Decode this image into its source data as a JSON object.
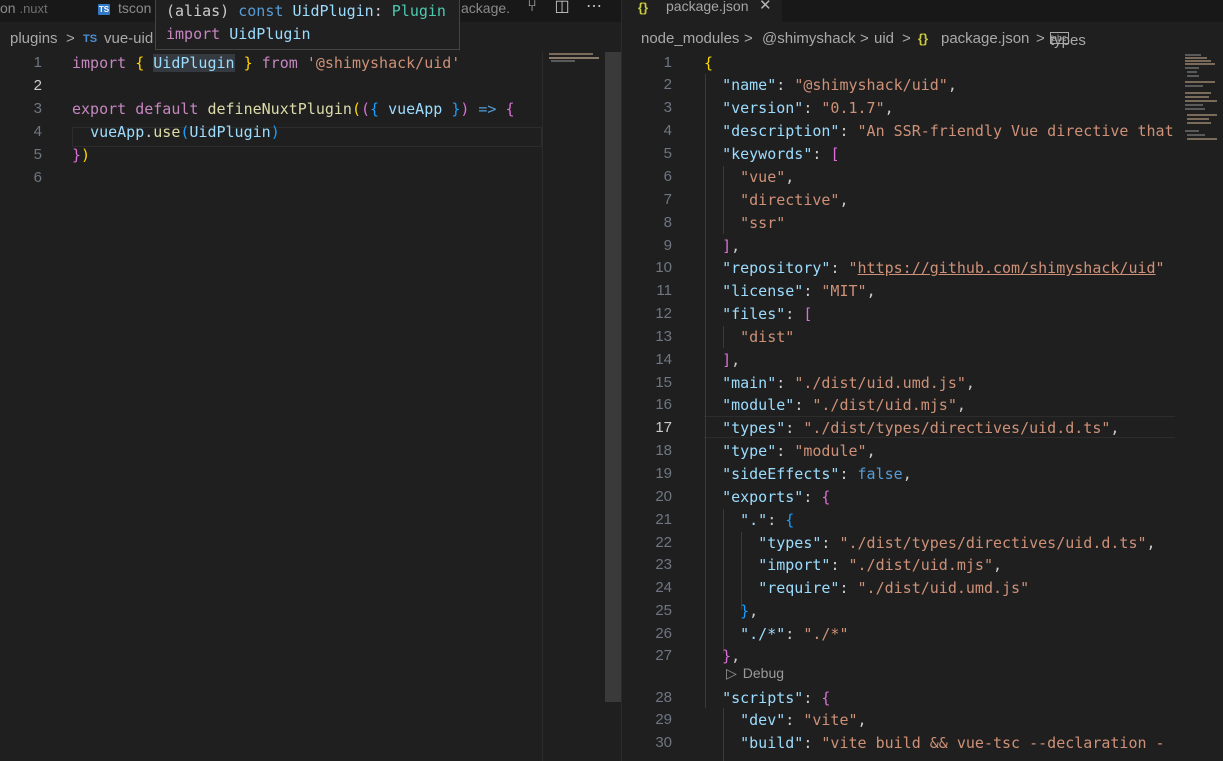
{
  "left_pane": {
    "tabs": [
      {
        "label": "on",
        "extra": ".nuxt"
      },
      {
        "label": "tscon",
        "icon": "typescript-icon"
      },
      {
        "label": "ackage.",
        "icon": ""
      }
    ],
    "breadcrumb": [
      "plugins",
      ">",
      "TS",
      "vue-uid"
    ],
    "code_lines": [
      "import { UidPlugin } from '@shimyshack/uid'",
      "",
      "export default defineNuxtPlugin(({ vueApp }) => {",
      "  vueApp.use(UidPlugin)",
      "})",
      ""
    ],
    "line_numbers": [
      "1",
      "2",
      "3",
      "4",
      "5",
      "6"
    ],
    "active_line": "2"
  },
  "hover_tooltip": {
    "line1": {
      "p1": "(alias) ",
      "p2": "const ",
      "p3": "UidPlugin",
      "p4": ": ",
      "p5": "Plugin"
    },
    "line2": {
      "p1": "import ",
      "p2": "UidPlugin"
    }
  },
  "right_pane": {
    "tab": {
      "label": "package.json",
      "icon": "braces-icon",
      "close": "✕"
    },
    "breadcrumb": [
      "node_modules",
      ">",
      "@shimyshack",
      ">",
      "uid",
      ">",
      "{}",
      "package.json",
      ">",
      "types"
    ],
    "line_numbers": [
      "1",
      "2",
      "3",
      "4",
      "5",
      "6",
      "7",
      "8",
      "9",
      "10",
      "11",
      "12",
      "13",
      "14",
      "15",
      "16",
      "17",
      "18",
      "19",
      "20",
      "21",
      "22",
      "23",
      "24",
      "25",
      "26",
      "27",
      "28",
      "29",
      "30"
    ],
    "active_line": "17",
    "codelens": "Debug",
    "json": {
      "name": "\"@shimyshack/uid\"",
      "version": "\"0.1.7\"",
      "description": "\"An SSR-friendly Vue directive that",
      "kw1": "\"vue\"",
      "kw2": "\"directive\"",
      "kw3": "\"ssr\"",
      "repository": "https://github.com/shimyshack/uid",
      "license": "\"MIT\"",
      "files1": "\"dist\"",
      "main": "\"./dist/uid.umd.js\"",
      "module": "\"./dist/uid.mjs\"",
      "types": "\"./dist/types/directives/uid.d.ts\"",
      "type": "\"module\"",
      "sideEffects": "false",
      "exp_types": "\"./dist/types/directives/uid.d.ts\"",
      "exp_import": "\"./dist/uid.mjs\"",
      "exp_require": "\"./dist/uid.umd.js\"",
      "star": "\"./*\"",
      "dev": "\"vite\"",
      "build": "\"vite build && vue-tsc --declaration -"
    }
  }
}
